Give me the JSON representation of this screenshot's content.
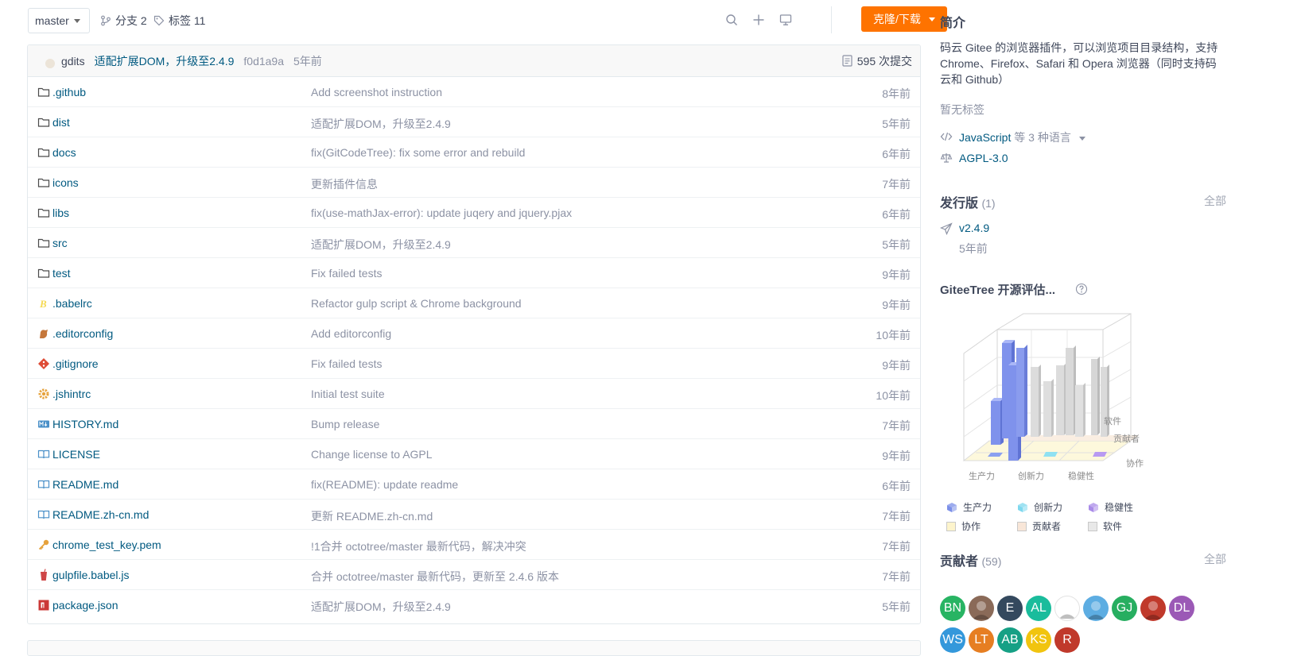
{
  "toolbar": {
    "branch": "master",
    "branches_label": "分支 2",
    "tags_label": "标签 11",
    "clone_label": "克隆/下载"
  },
  "commit": {
    "author": "gdits",
    "message": "适配扩展DOM，升级至2.4.9",
    "sha": "f0d1a9a",
    "time": "5年前",
    "count": "595 次提交"
  },
  "files": [
    {
      "name": ".github",
      "icon": "folder-icon",
      "commit": "Add screenshot instruction",
      "time": "8年前"
    },
    {
      "name": "dist",
      "icon": "folder-icon",
      "commit": "适配扩展DOM，升级至2.4.9",
      "time": "5年前"
    },
    {
      "name": "docs",
      "icon": "folder-icon",
      "commit": "fix(GitCodeTree): fix some error and rebuild",
      "time": "6年前"
    },
    {
      "name": "icons",
      "icon": "folder-icon",
      "commit": "更新插件信息",
      "time": "7年前"
    },
    {
      "name": "libs",
      "icon": "folder-icon",
      "commit": "fix(use-mathJax-error): update juqery and jquery.pjax",
      "time": "6年前"
    },
    {
      "name": "src",
      "icon": "folder-icon",
      "commit": "适配扩展DOM，升级至2.4.9",
      "time": "5年前"
    },
    {
      "name": "test",
      "icon": "folder-icon",
      "commit": "Fix failed tests",
      "time": "9年前"
    },
    {
      "name": ".babelrc",
      "icon": "babel-icon",
      "commit": "Refactor gulp script & Chrome background",
      "time": "9年前"
    },
    {
      "name": ".editorconfig",
      "icon": "editorconfig-icon",
      "commit": "Add editorconfig",
      "time": "10年前"
    },
    {
      "name": ".gitignore",
      "icon": "git-icon",
      "commit": "Fix failed tests",
      "time": "9年前"
    },
    {
      "name": ".jshintrc",
      "icon": "gear-icon",
      "commit": "Initial test suite",
      "time": "10年前"
    },
    {
      "name": "HISTORY.md",
      "icon": "markdown-icon",
      "commit": "Bump release",
      "time": "7年前"
    },
    {
      "name": "LICENSE",
      "icon": "book-icon",
      "commit": "Change license to AGPL",
      "time": "9年前"
    },
    {
      "name": "README.md",
      "icon": "book-icon",
      "commit": "fix(README): update readme",
      "time": "6年前"
    },
    {
      "name": "README.zh-cn.md",
      "icon": "book-icon",
      "commit": "更新 README.zh-cn.md",
      "time": "7年前"
    },
    {
      "name": "chrome_test_key.pem",
      "icon": "key-icon",
      "commit": "!1合并 octotree/master 最新代码，解决冲突",
      "time": "7年前"
    },
    {
      "name": "gulpfile.babel.js",
      "icon": "gulp-icon",
      "commit": "合并 octotree/master 最新代码，更新至 2.4.6 版本",
      "time": "7年前"
    },
    {
      "name": "package.json",
      "icon": "npm-icon",
      "commit": "适配扩展DOM，升级至2.4.9",
      "time": "5年前"
    }
  ],
  "sidebar": {
    "intro_title": "简介",
    "description": "码云 Gitee 的浏览器插件，可以浏览项目目录结构，支持 Chrome、Firefox、Safari 和 Opera 浏览器（同时支持码云和 Github）",
    "no_tags": "暂无标签",
    "language": "JavaScript",
    "language_more": "等 3 种语言",
    "license": "AGPL-3.0",
    "releases_title": "发行版",
    "releases_count": "(1)",
    "releases_all": "全部",
    "release_version": "v2.4.9",
    "release_time": "5年前",
    "eval_title": "GiteeTree 开源评估...",
    "chart_axis": [
      "生产力",
      "创新力",
      "稳健性"
    ],
    "chart_depth": [
      "软件",
      "贡献者",
      "协作"
    ],
    "legend": [
      {
        "label": "生产力",
        "color": "#7b8fe8",
        "kind": "cube"
      },
      {
        "label": "创新力",
        "color": "#7fd8ee",
        "kind": "cube"
      },
      {
        "label": "稳健性",
        "color": "#a98be8",
        "kind": "cube"
      },
      {
        "label": "协作",
        "color": "#fdf4cc",
        "kind": "square"
      },
      {
        "label": "贡献者",
        "color": "#f8e6d8",
        "kind": "square"
      },
      {
        "label": "软件",
        "color": "#e8e8e8",
        "kind": "square"
      }
    ],
    "contributors_title": "贡献者",
    "contributors_count": "(59)",
    "contributors_all": "全部",
    "avatars": [
      {
        "initials": "BN",
        "color": "#28b463"
      },
      {
        "initials": "",
        "color": "#8a6a58"
      },
      {
        "initials": "E",
        "color": "#34495e"
      },
      {
        "initials": "AL",
        "color": "#1abc9c"
      },
      {
        "initials": "",
        "color": "#ffffff"
      },
      {
        "initials": "",
        "color": "#5dade2"
      },
      {
        "initials": "GJ",
        "color": "#27ae60"
      },
      {
        "initials": "",
        "color": "#c0392b"
      },
      {
        "initials": "DL",
        "color": "#9b59b6"
      },
      {
        "initials": "WS",
        "color": "#3498db"
      },
      {
        "initials": "LT",
        "color": "#e67e22"
      },
      {
        "initials": "AB",
        "color": "#16a085"
      },
      {
        "initials": "KS",
        "color": "#f1c40f"
      },
      {
        "initials": "R",
        "color": "#c0392b"
      }
    ]
  }
}
